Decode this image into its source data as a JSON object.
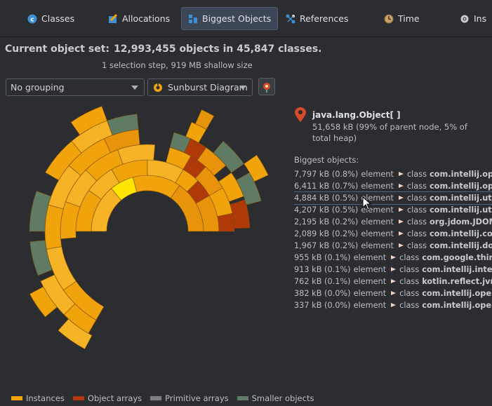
{
  "tabs": [
    {
      "label": "Classes",
      "icon": "class-icon",
      "active": false
    },
    {
      "label": "Allocations",
      "icon": "allocations-icon",
      "active": false
    },
    {
      "label": "Biggest Objects",
      "icon": "biggest-objects-icon",
      "active": true
    },
    {
      "label": "References",
      "icon": "references-icon",
      "active": false
    },
    {
      "label": "Time",
      "icon": "time-icon",
      "active": false
    },
    {
      "label": "Ins",
      "icon": "inspections-icon",
      "active": false
    }
  ],
  "summary": {
    "label": "Current object set:",
    "value": "12,993,455 objects in 45,847 classes.",
    "sub": "1 selection step, 919 MB shallow size"
  },
  "controls": {
    "grouping": "No grouping",
    "view": "Sunburst Diagram"
  },
  "selected": {
    "name": "java.lang.Object[ ]",
    "info": "51,658 kB (99% of parent node, 5% of total heap)"
  },
  "biggest_label": "Biggest objects:",
  "objects": [
    {
      "size": "7,797 kB (0.8%)",
      "kind": "element",
      "cls": "class",
      "name": "com.intellij.openapi"
    },
    {
      "size": "6,411 kB (0.7%)",
      "kind": "element",
      "cls": "class",
      "name": "com.intellij.openapi"
    },
    {
      "size": "4,884 kB (0.5%)",
      "kind": "element",
      "cls": "class",
      "name": "com.intellij.util.SmartList"
    },
    {
      "size": "4,207 kB (0.5%)",
      "kind": "element",
      "cls": "class",
      "name": "com.intellij.util.io"
    },
    {
      "size": "2,195 kB (0.2%)",
      "kind": "element",
      "cls": "class",
      "name": "org.jdom.JDOMFactory"
    },
    {
      "size": "2,089 kB (0.2%)",
      "kind": "element",
      "cls": "class",
      "name": "com.intellij.configurations"
    },
    {
      "size": "1,967 kB (0.2%)",
      "kind": "element",
      "cls": "class",
      "name": "com.intellij.documentation"
    },
    {
      "size": "955 kB (0.1%)",
      "kind": "element",
      "cls": "class",
      "name": "com.google.thirdparty"
    },
    {
      "size": "913 kB (0.1%)",
      "kind": "element",
      "cls": "class",
      "name": "com.intellij.internal"
    },
    {
      "size": "762 kB (0.1%)",
      "kind": "element",
      "cls": "class",
      "name": "kotlin.reflect.jvm"
    },
    {
      "size": "382 kB (0.0%)",
      "kind": "element",
      "cls": "class",
      "name": "com.intellij.openapi"
    },
    {
      "size": "337 kB (0.0%)",
      "kind": "element",
      "cls": "class",
      "name": "com.intellij.openapi"
    }
  ],
  "legend": [
    {
      "label": "Instances",
      "color": "#f0a30a"
    },
    {
      "label": "Object arrays",
      "color": "#b0390a"
    },
    {
      "label": "Primitive arrays",
      "color": "#7f8085"
    },
    {
      "label": "Smaller objects",
      "color": "#5f7b64"
    }
  ],
  "colors": {
    "instances": "#f0a30a",
    "object_arrays": "#b0390a",
    "primitive_arrays": "#7f8085",
    "smaller_objects": "#5f7b64",
    "highlight": "#ffe500"
  }
}
